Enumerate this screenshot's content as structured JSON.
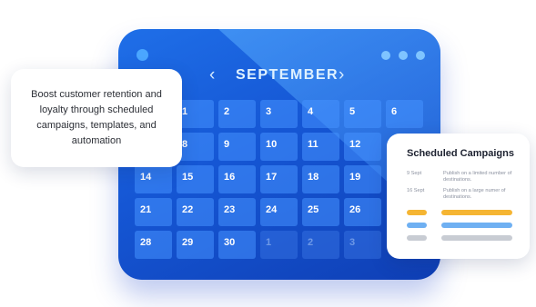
{
  "calendar": {
    "month": "SEPTEMBER",
    "prev_icon": "‹",
    "next_icon": "›",
    "weeks": [
      [
        {
          "d": "",
          "m": false,
          "h": true
        },
        {
          "d": "1",
          "m": false
        },
        {
          "d": "2",
          "m": false
        },
        {
          "d": "3",
          "m": false
        },
        {
          "d": "4",
          "m": false
        },
        {
          "d": "5",
          "m": false
        },
        {
          "d": "6",
          "m": false
        }
      ],
      [
        {
          "d": "",
          "m": false,
          "h": true
        },
        {
          "d": "8",
          "m": false
        },
        {
          "d": "9",
          "m": false
        },
        {
          "d": "10",
          "m": false
        },
        {
          "d": "11",
          "m": false
        },
        {
          "d": "12",
          "m": false
        },
        {
          "d": "",
          "m": false,
          "h": true
        }
      ],
      [
        {
          "d": "14",
          "m": false
        },
        {
          "d": "15",
          "m": false
        },
        {
          "d": "16",
          "m": false
        },
        {
          "d": "17",
          "m": false
        },
        {
          "d": "18",
          "m": false
        },
        {
          "d": "19",
          "m": false
        },
        {
          "d": "",
          "m": false,
          "h": true
        }
      ],
      [
        {
          "d": "21",
          "m": false
        },
        {
          "d": "22",
          "m": false
        },
        {
          "d": "23",
          "m": false
        },
        {
          "d": "24",
          "m": false
        },
        {
          "d": "25",
          "m": false
        },
        {
          "d": "26",
          "m": false
        },
        {
          "d": "",
          "m": false,
          "h": true
        }
      ],
      [
        {
          "d": "28",
          "m": false
        },
        {
          "d": "29",
          "m": false
        },
        {
          "d": "30",
          "m": false
        },
        {
          "d": "1",
          "m": true
        },
        {
          "d": "2",
          "m": true
        },
        {
          "d": "3",
          "m": true
        },
        {
          "d": "",
          "m": false,
          "h": true
        }
      ]
    ]
  },
  "callout": {
    "text": "Boost customer retention and loyalty through scheduled campaigns, templates, and automation"
  },
  "scheduled": {
    "title": "Scheduled Campaigns",
    "entries": [
      {
        "date": "9 Sept",
        "desc": "Publish on a limited number of destinations."
      },
      {
        "date": "16 Sept",
        "desc": "Publish on a large numer of destinations."
      }
    ],
    "bars": [
      {
        "color": "#f5b533"
      },
      {
        "color": "#6fb0f2"
      },
      {
        "color": "#c8ccd3"
      }
    ]
  }
}
